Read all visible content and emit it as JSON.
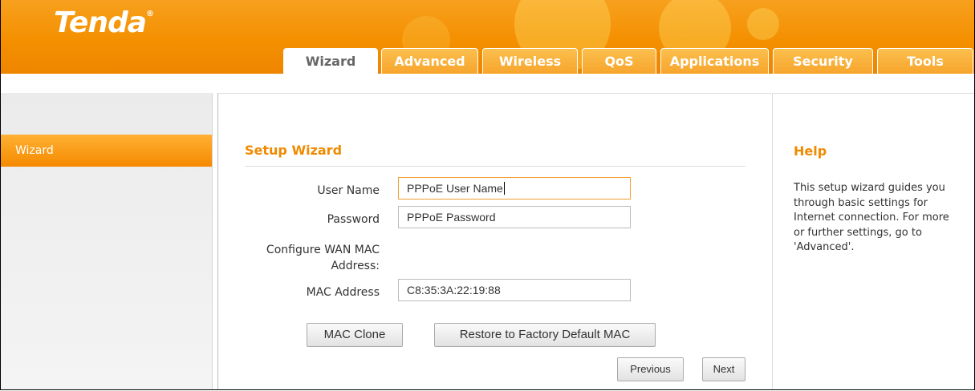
{
  "brand": {
    "logo_text": "Tenda",
    "registered_mark": "®"
  },
  "nav": {
    "tabs": [
      {
        "label": "Wizard",
        "active": true
      },
      {
        "label": "Advanced",
        "active": false
      },
      {
        "label": "Wireless",
        "active": false
      },
      {
        "label": "QoS",
        "active": false
      },
      {
        "label": "Applications",
        "active": false
      },
      {
        "label": "Security",
        "active": false
      },
      {
        "label": "Tools",
        "active": false
      }
    ]
  },
  "sidebar": {
    "items": [
      {
        "label": "Wizard",
        "active": true
      }
    ]
  },
  "main": {
    "title": "Setup Wizard",
    "fields": {
      "user_name": {
        "label": "User Name",
        "value": "PPPoE User Name"
      },
      "password": {
        "label": "Password",
        "value": "PPPoE Password"
      },
      "wan_mac_label_line1": "Configure WAN MAC",
      "wan_mac_label_line2": "Address:",
      "mac_address": {
        "label": "MAC Address",
        "value": "C8:35:3A:22:19:88"
      }
    },
    "buttons": {
      "mac_clone": "MAC Clone",
      "restore_default_mac": "Restore to Factory Default MAC",
      "previous": "Previous",
      "next": "Next"
    }
  },
  "help": {
    "title": "Help",
    "text": "This setup wizard guides you through basic settings for Internet connection. For more or further settings, go to 'Advanced'."
  },
  "colors": {
    "brand_orange": "#f49000",
    "title_orange": "#f08a00",
    "tab_light": "#fbbf4e"
  }
}
